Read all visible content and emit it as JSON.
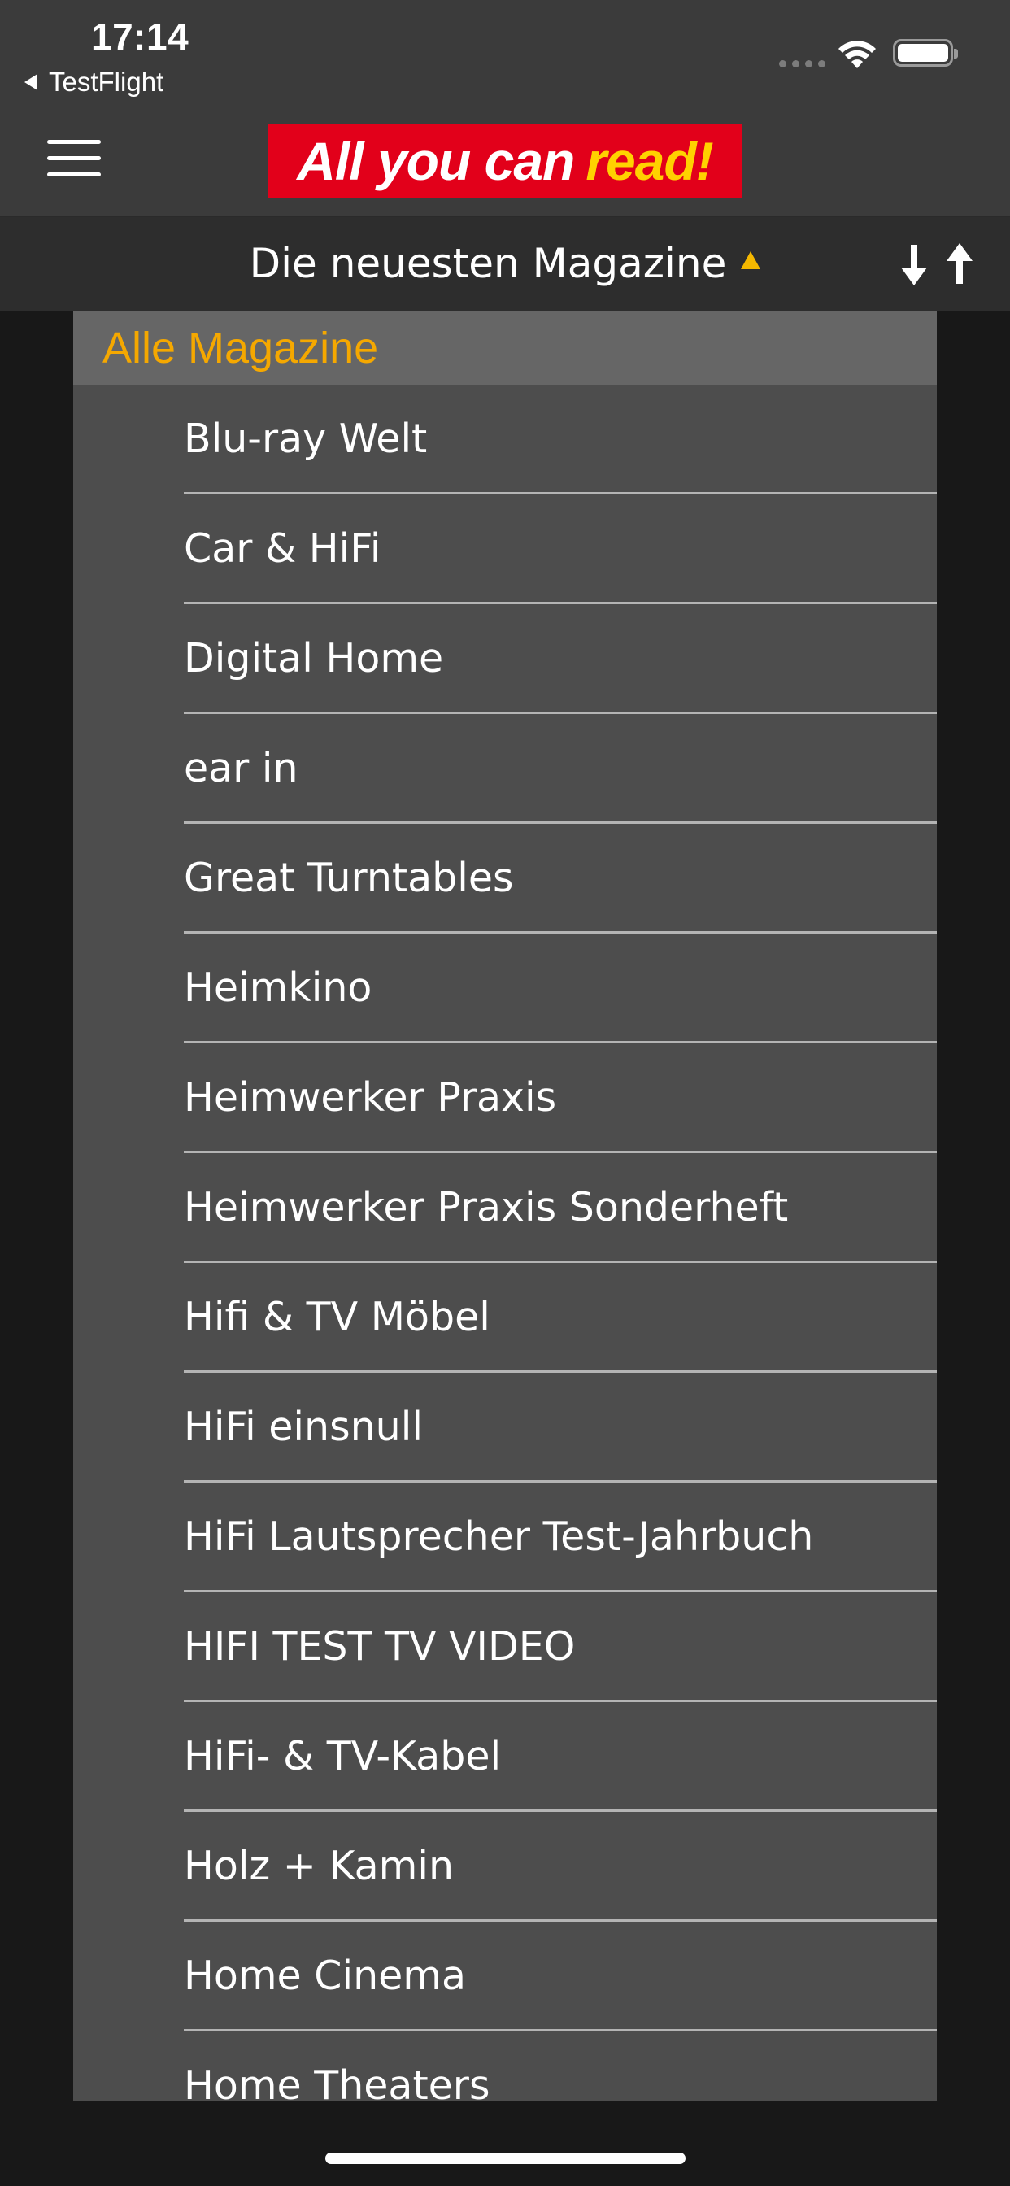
{
  "status_bar": {
    "time": "17:14",
    "back_label": "TestFlight"
  },
  "header": {
    "logo_white": "All you can",
    "logo_yellow": "read!",
    "colors": {
      "bar": "#3b3b3b",
      "logo_bg": "#e2001a",
      "logo_accent": "#ffd200"
    }
  },
  "sort_bar": {
    "title": "Die neuesten Magazine",
    "caret_icon": "triangle-up-icon",
    "sort_icon": "sort-arrows-icon"
  },
  "panel": {
    "header": "Alle Magazine",
    "accent": "#f5a800",
    "items": [
      "Blu-ray Welt",
      "Car & HiFi",
      "Digital Home",
      "ear in",
      "Great Turntables",
      "Heimkino",
      "Heimwerker Praxis",
      "Heimwerker Praxis Sonderheft",
      "Hifi & TV Möbel",
      "HiFi einsnull",
      "HiFi Lautsprecher Test-Jahrbuch",
      "HIFI TEST TV VIDEO",
      "HiFi- & TV-Kabel",
      "Holz + Kamin",
      "Home Cinema",
      "Home Theaters"
    ]
  }
}
